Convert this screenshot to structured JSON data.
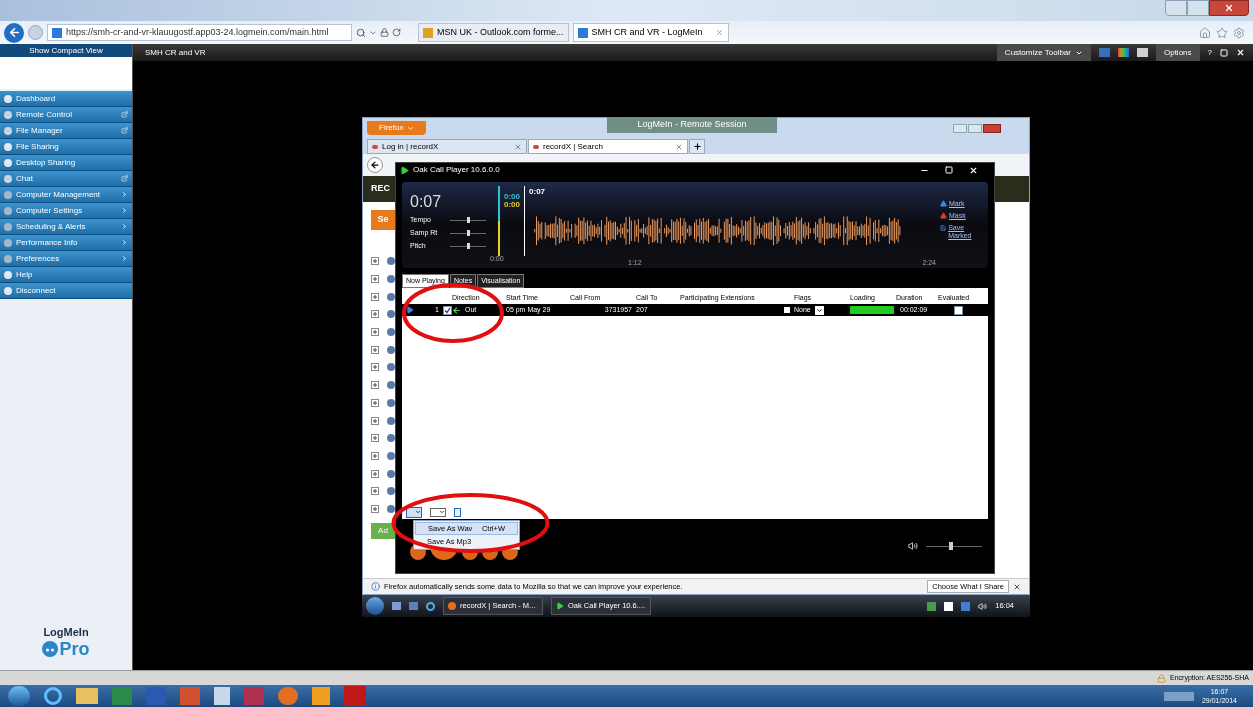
{
  "browser": {
    "url": "https://smh-cr-and-vr-klauugostf.app03-24.logmein.com/main.html",
    "tabs": [
      {
        "label": "MSN UK - Outlook.com forme...",
        "selected": false
      },
      {
        "label": "SMH CR and VR - LogMeIn",
        "selected": true
      }
    ]
  },
  "sidebar": {
    "compact_view": "Show Compact View",
    "items": [
      {
        "label": "Dashboard",
        "kind": "plain"
      },
      {
        "label": "Remote Control",
        "kind": "popout"
      },
      {
        "label": "File Manager",
        "kind": "popout"
      },
      {
        "label": "File Sharing",
        "kind": "plain"
      },
      {
        "label": "Desktop Sharing",
        "kind": "plain"
      },
      {
        "label": "Chat",
        "kind": "popout"
      },
      {
        "label": "Computer Management",
        "kind": "submenu"
      },
      {
        "label": "Computer Settings",
        "kind": "submenu"
      },
      {
        "label": "Scheduling & Alerts",
        "kind": "submenu"
      },
      {
        "label": "Performance Info",
        "kind": "submenu"
      },
      {
        "label": "Preferences",
        "kind": "submenu"
      },
      {
        "label": "Help",
        "kind": "plain"
      },
      {
        "label": "Disconnect",
        "kind": "plain"
      }
    ],
    "logo": {
      "name": "LogMeIn",
      "edition": "Pro"
    }
  },
  "toolbar": {
    "title": "SMH CR and VR",
    "customize": "Customize Toolbar",
    "options": "Options",
    "help": "?"
  },
  "remote": {
    "session_title": "LogMeIn - Remote Session",
    "firefox_button": "Firefox",
    "tabs": [
      {
        "label": "Log in | recordX",
        "selected": false
      },
      {
        "label": "recordX | Search",
        "selected": true
      }
    ],
    "page_heading": "REC",
    "search_button": "Se",
    "add_button": "Ad",
    "notification": {
      "text": "Firefox automatically sends some data to Mozilla so that we can improve your experience.",
      "button": "Choose What I Share"
    },
    "taskbar": {
      "items": [
        {
          "label": "recordX | Search - M...",
          "kind": "firefox"
        },
        {
          "label": "Oak Call Player 10.6....",
          "kind": "player"
        }
      ],
      "clock": "16:04"
    }
  },
  "player": {
    "title": "Oak Call Player 10.6.0.0",
    "position": "0:07",
    "markers": [
      {
        "label": "0:00",
        "color": "#33c0d0"
      },
      {
        "label": "0:00",
        "color": "#e8d020"
      },
      {
        "label": "0:07",
        "color": "#ffffff"
      }
    ],
    "sliders": [
      {
        "label": "Tempo",
        "level": 0.5
      },
      {
        "label": "Samp Rt",
        "level": 0.5
      },
      {
        "label": "Pitch",
        "level": 0.5
      }
    ],
    "timeline": [
      "0:00",
      "1:12",
      "2:24"
    ],
    "actions": [
      {
        "label": "Mark",
        "kind": "mark"
      },
      {
        "label": "Mask",
        "kind": "mask"
      },
      {
        "label": "Save Marked",
        "kind": "save"
      }
    ],
    "tabs": [
      {
        "label": "Now Playing",
        "selected": true
      },
      {
        "label": "Notes",
        "selected": false
      },
      {
        "label": "Visualisation",
        "selected": false
      }
    ],
    "columns": [
      "Direction",
      "Start Time",
      "Call From",
      "Call To",
      "Participating Extensions",
      "Flags",
      "Loading",
      "Duration",
      "Evaluated"
    ],
    "rows": [
      {
        "index": "1",
        "checked": true,
        "direction": "Out",
        "start_time": "05 pm May 29",
        "call_from": "3731957",
        "call_to": "207",
        "flag": "None",
        "loading": {
          "level": 1
        },
        "duration": "00:02:09",
        "evaluated": false
      }
    ],
    "menu": [
      {
        "label": "Save As Wav",
        "shortcut": "Ctrl+W",
        "selected": true
      },
      {
        "label": "Save As Mp3",
        "selected": false
      }
    ],
    "volume": {
      "level": 0.45
    }
  },
  "status_bar": {
    "encryption": "Encryption: AES256-SHA"
  },
  "windows_taskbar": {
    "time": "16:07",
    "date": "29/01/2014"
  }
}
